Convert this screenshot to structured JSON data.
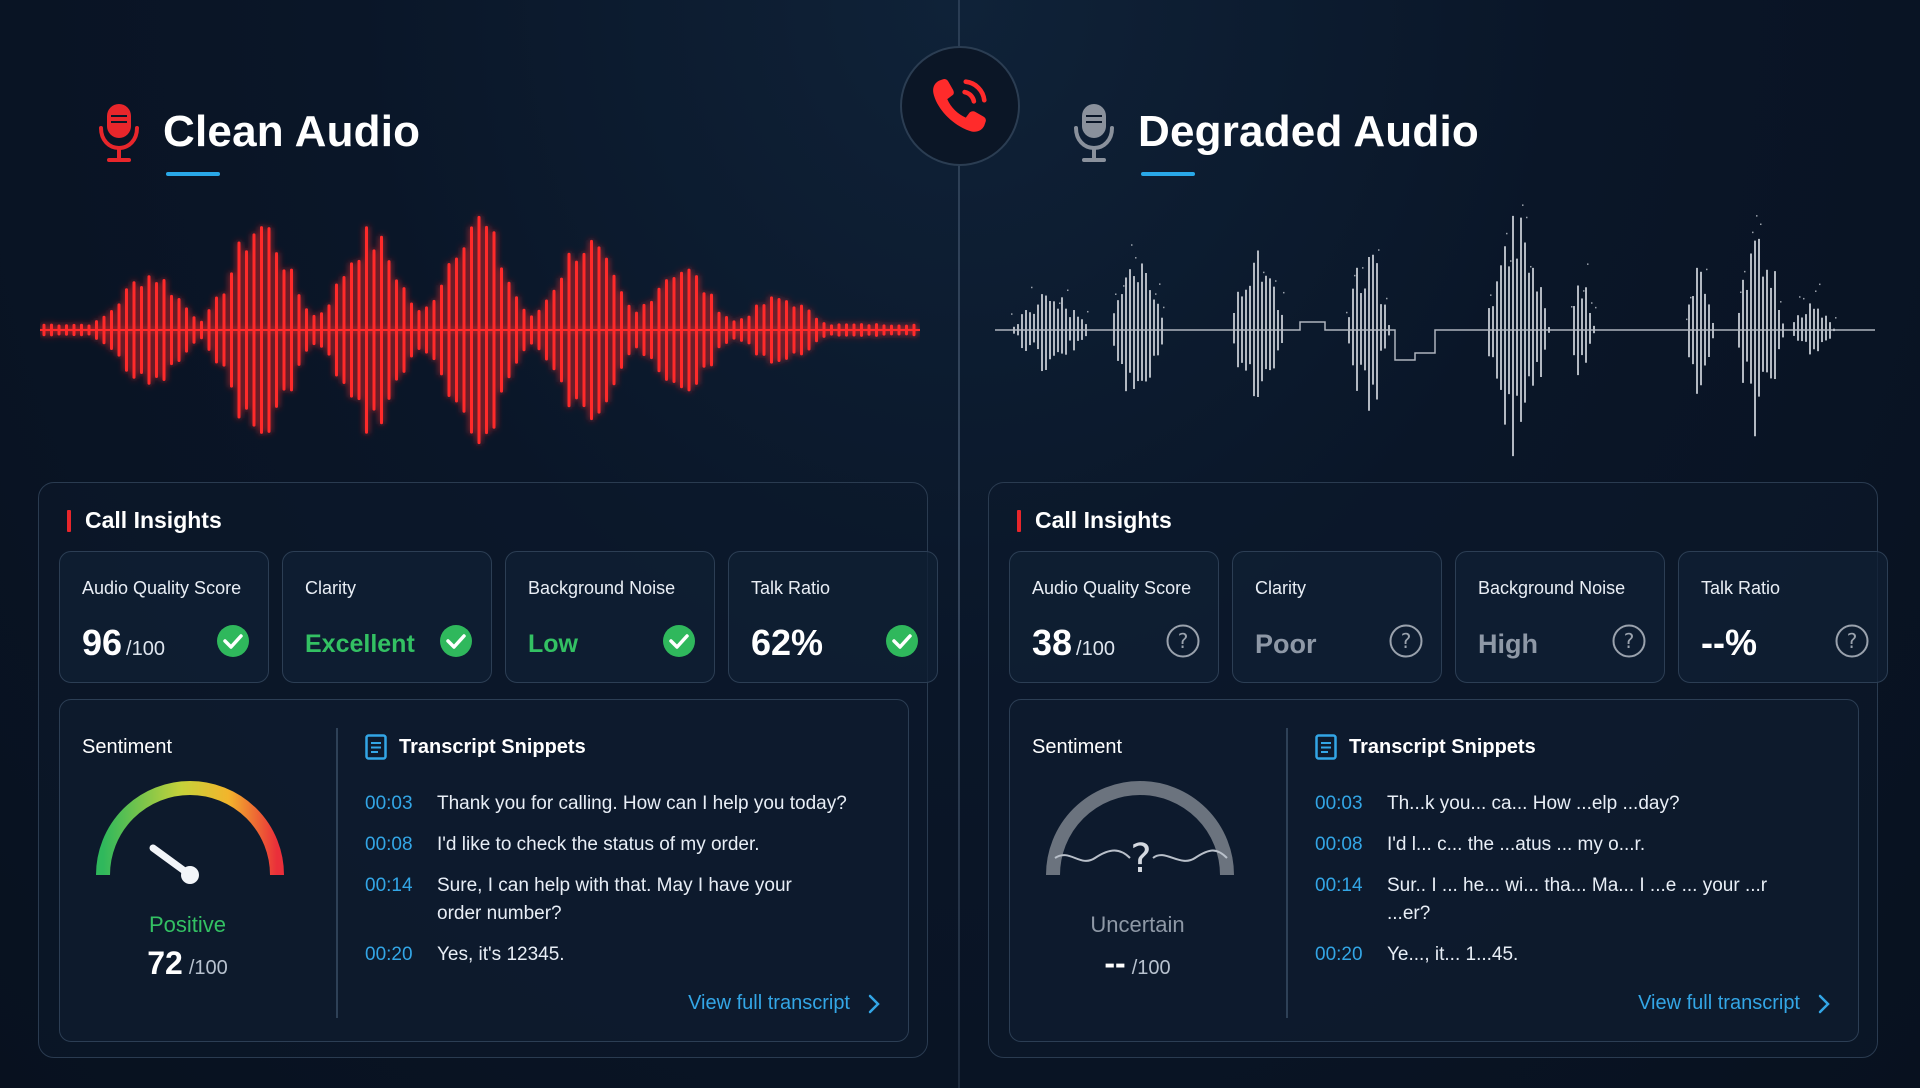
{
  "colors": {
    "clean_accent": "#e8262b",
    "degraded_accent": "#aeb4bd",
    "link_blue": "#33a6e6",
    "good_green": "#33c163",
    "neutral_grey": "#8e98a6"
  },
  "center_icon": "phone-call-icon",
  "clean": {
    "title": "Clean Audio",
    "icon": "microphone-icon",
    "insights_title": "Call Insights",
    "metrics": [
      {
        "label": "Audio Quality Score",
        "value": "96",
        "suffix": "/100",
        "status": "check-circle-icon"
      },
      {
        "label": "Clarity",
        "value": "Excellent",
        "status": "check-circle-icon"
      },
      {
        "label": "Background Noise",
        "value": "Low",
        "status": "check-circle-icon"
      },
      {
        "label": "Talk Ratio",
        "value": "62%",
        "status": "check-circle-icon"
      }
    ],
    "sentiment": {
      "label": "Sentiment",
      "word": "Positive",
      "score": "72",
      "suffix": "/100"
    },
    "transcript": {
      "title": "Transcript Snippets",
      "rows": [
        {
          "ts": "00:03",
          "text": "Thank you for calling. How can I help you today?"
        },
        {
          "ts": "00:08",
          "text": "I'd like to check the status of my order."
        },
        {
          "ts": "00:14",
          "text": "Sure, I can help with that. May I have your order number?"
        },
        {
          "ts": "00:20",
          "text": "Yes, it's 12345."
        }
      ],
      "link": "View full transcript"
    }
  },
  "degraded": {
    "title": "Degraded Audio",
    "icon": "microphone-icon",
    "insights_title": "Call Insights",
    "metrics": [
      {
        "label": "Audio Quality Score",
        "value": "38",
        "suffix": "/100",
        "status": "question-circle-icon"
      },
      {
        "label": "Clarity",
        "value": "Poor",
        "status": "question-circle-icon"
      },
      {
        "label": "Background Noise",
        "value": "High",
        "status": "question-circle-icon"
      },
      {
        "label": "Talk Ratio",
        "value": "--%",
        "status": "question-circle-icon"
      }
    ],
    "sentiment": {
      "label": "Sentiment",
      "word": "Uncertain",
      "score": "--",
      "suffix": "/100"
    },
    "transcript": {
      "title": "Transcript Snippets",
      "rows": [
        {
          "ts": "00:03",
          "text": "Th...k you... ca... How ...elp ...day?"
        },
        {
          "ts": "00:08",
          "text": "I'd l... c... the ...atus ... my o...r."
        },
        {
          "ts": "00:14",
          "text": "Sur.. I ... he... wi... tha... Ma... I ...e ... your ...r ...er?"
        },
        {
          "ts": "00:20",
          "text": "Ye..., it... 1...45."
        }
      ],
      "link": "View full transcript"
    }
  }
}
